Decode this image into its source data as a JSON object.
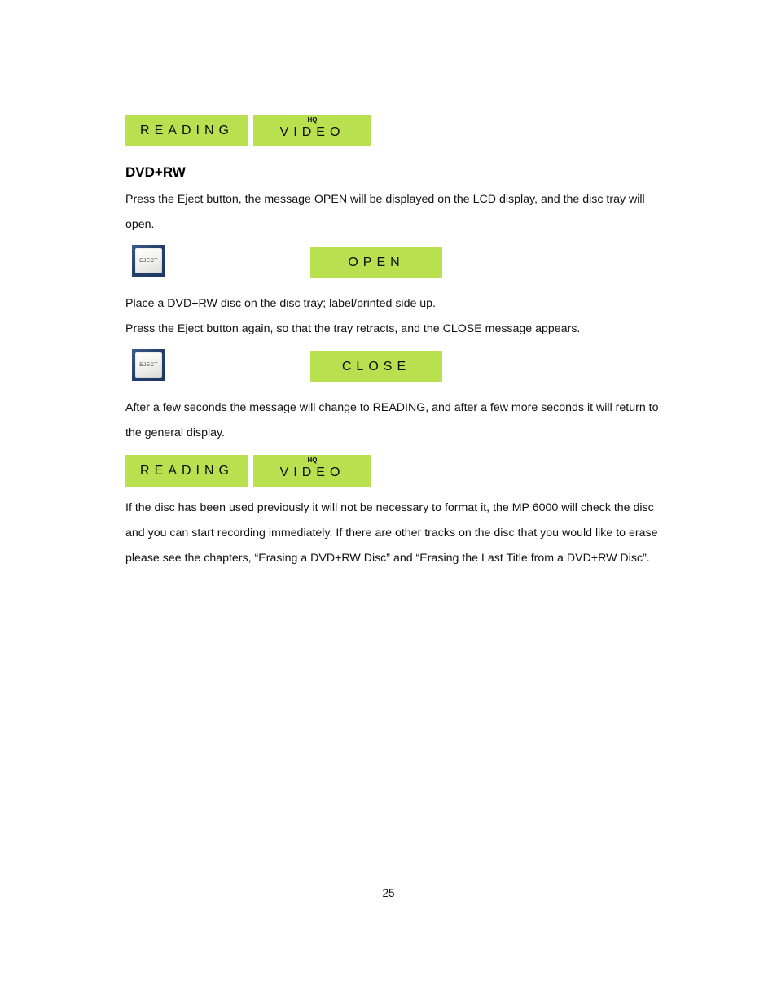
{
  "document": {
    "page_number": "25",
    "section_heading": "DVD+RW"
  },
  "displays": {
    "reading": "READING",
    "video_mode": "HQ",
    "video": "VIDEO",
    "open": "OPEN",
    "close": "CLOSE"
  },
  "buttons": {
    "eject_label": "EJECT"
  },
  "paragraphs": {
    "p1": "Press the Eject button, the message OPEN will be displayed on the LCD display, and the disc tray will open.",
    "p2": "Place a DVD+RW disc on the disc tray; label/printed side up.",
    "p3": "Press the Eject button again, so that the tray retracts, and the CLOSE message appears.",
    "p4": "After a few seconds the message will change to READING, and after a few more seconds it will return to the general display.",
    "p5": "If the disc has been used previously it will not be necessary to format it, the MP 6000 will check the disc and you can start recording immediately. If there are other tracks on the disc that you would like to erase please see the chapters, “Erasing a DVD+RW Disc” and “Erasing the Last Title from a DVD+RW Disc”."
  },
  "colors": {
    "lcd_background": "#b9e04f",
    "lcd_text": "#0d0d0d",
    "eject_frame": "#2d4a77",
    "eject_face": "#f2f2f0"
  }
}
